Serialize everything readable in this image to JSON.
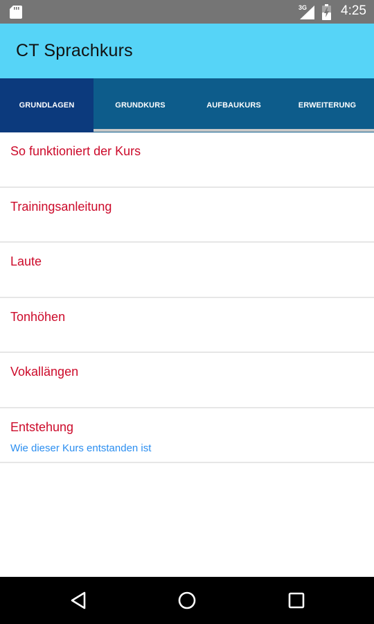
{
  "status_bar": {
    "network_label": "3G",
    "time": "4:25",
    "icons": [
      "sd-card-icon",
      "signal-icon",
      "battery-charging-icon"
    ]
  },
  "app_bar": {
    "title": "CT Sprachkurs",
    "background": "#56d4f7"
  },
  "tabs": {
    "selected": 0,
    "items": [
      {
        "label": "GRUNDLAGEN"
      },
      {
        "label": "GRUNDKURS"
      },
      {
        "label": "AUFBAUKURS"
      },
      {
        "label": "ERWEITERUNG"
      }
    ]
  },
  "list": {
    "items": [
      {
        "title": "So funktioniert der Kurs"
      },
      {
        "title": "Trainingsanleitung"
      },
      {
        "title": "Laute"
      },
      {
        "title": "Tonhöhen"
      },
      {
        "title": "Vokallängen"
      },
      {
        "title": "Entstehung",
        "subtitle": "Wie dieser Kurs entstanden ist"
      }
    ]
  },
  "nav_bar": {
    "buttons": [
      "back-icon",
      "home-icon",
      "recents-icon"
    ]
  },
  "colors": {
    "title_text": "#cc0a2a",
    "subtitle_text": "#2b8ef0",
    "tab_bar": "#0d5c8b",
    "tab_selected": "#0c3a7d"
  }
}
